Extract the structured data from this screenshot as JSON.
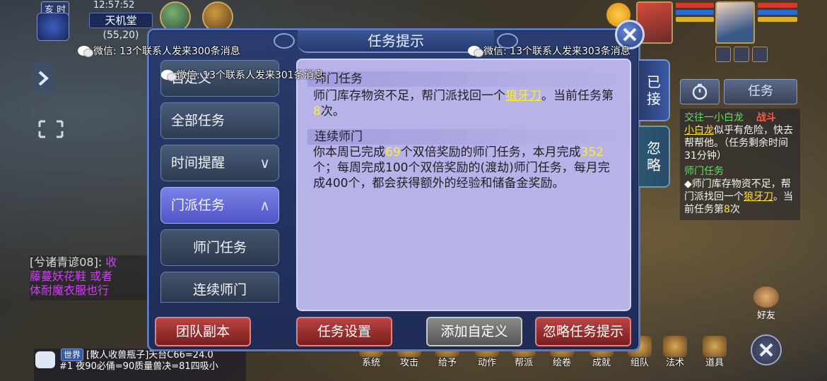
{
  "status": {
    "time_of_day": "亥 时",
    "clock": "12:57:52",
    "map_name": "天机堂",
    "coords": "(55,20)"
  },
  "notifications": [
    {
      "text": "微信: 13个联系人发来300条消息"
    },
    {
      "text": "微信: 13个联系人发来303条消息"
    },
    {
      "text": "微信: 13个联系人发来301条消息"
    }
  ],
  "dialog": {
    "title": "任务提示",
    "nav": [
      {
        "label": "自定义"
      },
      {
        "label": "全部任务"
      },
      {
        "label": "时间提醒",
        "chevron": "∨"
      },
      {
        "label": "门派任务",
        "chevron": "∧"
      },
      {
        "label": "师门任务"
      },
      {
        "label": "连续师门"
      }
    ],
    "content": {
      "section1_title": "师门任务",
      "s1_part1": "师门库存物资不足，帮门派找回一个",
      "s1_item": "狼牙刀",
      "s1_part2": "。当前任务第",
      "s1_count": "8",
      "s1_part3": "次。",
      "section2_title": "连续师门",
      "s2_part1": "你本周已完成",
      "s2_week_done": "69",
      "s2_part2": "个双倍奖励的师门任务，本月完成",
      "s2_month_done": "352",
      "s2_part3": "个；每周完成100个双倍奖励的(渡劫)师门任务，每月完成400个，都会获得额外的经验和储备金奖励。"
    },
    "buttons": {
      "team_dungeon": "团队副本",
      "task_settings": "任务设置",
      "add_custom": "添加自定义",
      "ignore_hints": "忽略任务提示"
    },
    "side_tabs": {
      "accepted": "已接",
      "ignored": "忽略"
    }
  },
  "tracker": {
    "tab_task": "任务",
    "q1_title": "交往一小白龙",
    "q1_tag": "战斗",
    "q1_npc": "小白龙",
    "q1_text": "似乎有危险，快去帮帮他。（任务剩余时间31分钟）",
    "q2_title": "师门任务",
    "q2_part1": "◆师门库存物资不足，帮门派找回一个",
    "q2_item": "狼牙刀",
    "q2_part2": "。当前任务第",
    "q2_count": "8",
    "q2_part3": "次"
  },
  "chat": {
    "line1_name": "[兮诸青谚08]:",
    "line1_cont": "收",
    "line2": "藤蔓妖花鞋 或者",
    "line3": "体耐魔衣服也行"
  },
  "world_chat": {
    "tag": "世界",
    "line1": "[散人收兽瓶子]天台C66=24.0",
    "line2": "#1 夜90必俑=90质量兽决=81四吸小"
  },
  "toolbar": [
    "系统",
    "攻击",
    "给予",
    "动作",
    "帮派",
    "绘卷",
    "成就",
    "组队",
    "法术",
    "道具"
  ],
  "friend_label": "好友",
  "colors": {
    "highlight": "#ffee20",
    "dialog_bg": "#1e2c56",
    "content_bg": "#b7b3e8",
    "red_button": "#b84444"
  }
}
